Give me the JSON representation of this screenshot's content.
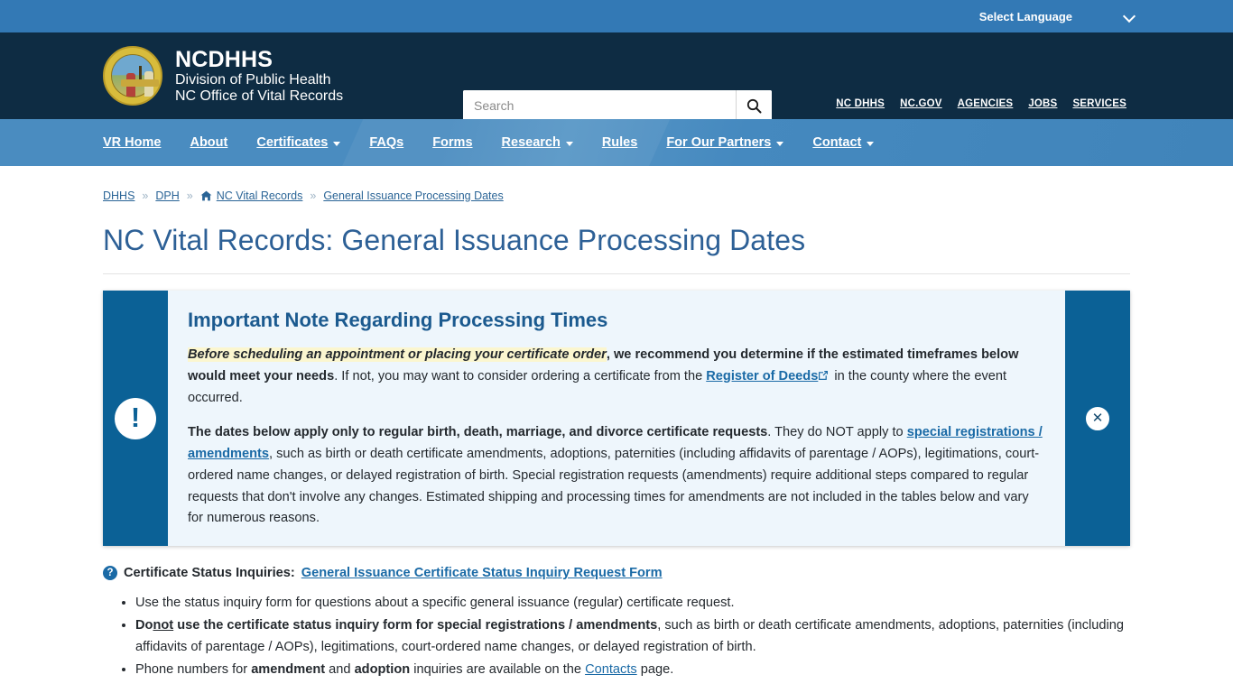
{
  "topbar": {
    "language_label": "Select Language",
    "chevron_icon": "chevron-down-icon"
  },
  "masthead": {
    "agency_abbrev": "NCDHHS",
    "division": "Division of Public Health",
    "office": "NC Office of Vital Records",
    "seal_icon": "north-carolina-state-seal",
    "search": {
      "placeholder": "Search",
      "value": "",
      "button_icon": "search-icon"
    },
    "util_links": [
      {
        "label": "NC DHHS"
      },
      {
        "label": "NC.GOV"
      },
      {
        "label": "AGENCIES"
      },
      {
        "label": "JOBS"
      },
      {
        "label": "SERVICES"
      }
    ]
  },
  "nav": {
    "items": [
      {
        "label": "VR Home",
        "has_dropdown": false
      },
      {
        "label": "About",
        "has_dropdown": false
      },
      {
        "label": "Certificates",
        "has_dropdown": true
      },
      {
        "label": "FAQs",
        "has_dropdown": false
      },
      {
        "label": "Forms",
        "has_dropdown": false
      },
      {
        "label": "Research",
        "has_dropdown": true
      },
      {
        "label": "Rules",
        "has_dropdown": false
      },
      {
        "label": "For Our Partners",
        "has_dropdown": true
      },
      {
        "label": "Contact",
        "has_dropdown": true
      }
    ]
  },
  "breadcrumb": {
    "separator": "»",
    "items": [
      {
        "label": "DHHS",
        "icon": null
      },
      {
        "label": "DPH",
        "icon": null
      },
      {
        "label": "NC Vital Records",
        "icon": "home-icon"
      },
      {
        "label": "General Issuance Processing Dates",
        "icon": null
      }
    ]
  },
  "page": {
    "title": "NC Vital Records: General Issuance Processing Dates"
  },
  "alert": {
    "icon": "exclamation-icon",
    "close_icon": "close-icon",
    "heading": "Important Note Regarding Processing Times",
    "p1": {
      "highlight": "Before scheduling an appointment or placing your certificate order",
      "bold_part": ", we recommend you determine if the estimated timeframes below would meet your needs",
      "rest_a": ". If not, you may want to consider ordering a certificate from the ",
      "link": "Register of Deeds",
      "external_icon": "external-link-icon",
      "rest_b": " in the county where the event occurred."
    },
    "p2": {
      "bold_part": "The dates below apply only to regular birth, death, marriage, and divorce certificate requests",
      "mid": ". They do NOT apply to ",
      "link": "special registrations / amendments",
      "rest": ", such as birth or death certificate amendments, adoptions, paternities (including affidavits of parentage / AOPs), legitimations, court-ordered name changes, or delayed registration of birth. Special registration requests (amendments) require additional steps compared to regular requests that don't involve any changes. Estimated shipping and processing times for amendments are not included in the tables below and vary for numerous reasons."
    }
  },
  "status_inquiries": {
    "icon": "question-circle-icon",
    "label": "Certificate Status Inquiries:",
    "link": "General Issuance Certificate Status Inquiry Request Form"
  },
  "notes": {
    "item1": "Use the status inquiry form for questions about a specific general issuance (regular) certificate request.",
    "item2": {
      "do": "Do",
      "not": "not",
      "bold_rest": "use the certificate status inquiry form for special registrations / amendments",
      "rest": ", such as birth or death certificate amendments, adoptions, paternities (including affidavits of parentage / AOPs), legitimations, court-ordered name changes, or delayed registration of birth."
    },
    "item3": {
      "pre": "Phone numbers for ",
      "b1": "amendment",
      "mid": " and ",
      "b2": "adoption",
      "post": " inquiries are available on the ",
      "link": "Contacts",
      "tail": " page."
    }
  },
  "colors": {
    "top_bar": "#3379b5",
    "masthead": "#0e2c43",
    "nav": "#4a8cc0",
    "alert_accent": "#0b6196",
    "alert_bg": "#eef6fc",
    "title": "#2d6096",
    "link": "#1a6aa6",
    "highlight": "#fbf6cf"
  }
}
